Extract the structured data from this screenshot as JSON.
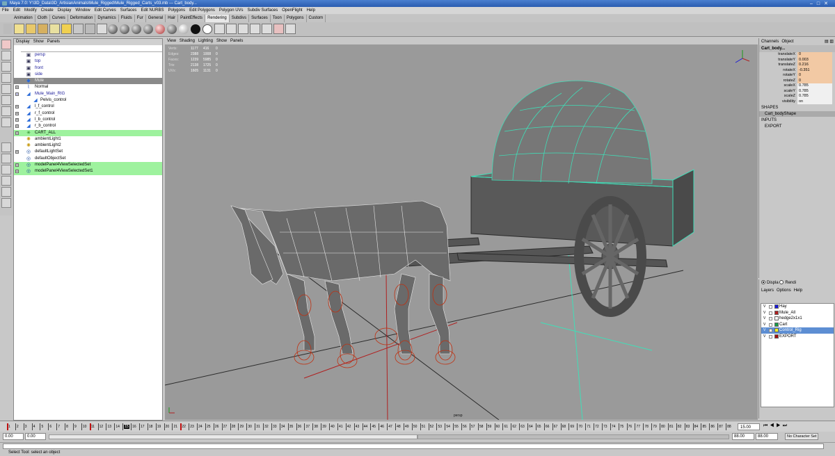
{
  "window": {
    "title": "Maya 7.0: Y:\\3D_Data\\3D_ArtisianAnimals\\Mule_Rigged\\Mule_Rigged_Carts_v03.mb   ---   Cart_body..."
  },
  "menubar": [
    "File",
    "Edit",
    "Modify",
    "Create",
    "Display",
    "Window",
    "Edit Curves",
    "Surfaces",
    "Edit NURBS",
    "Polygons",
    "Edit Polygons",
    "Polygon UVs",
    "Subdiv Surfaces",
    "OpenFlight",
    "Help"
  ],
  "shelf_tabs": [
    "Animation",
    "Cloth",
    "Curves",
    "Deformation",
    "Dynamics",
    "Fluids",
    "Fur",
    "General",
    "Hair",
    "PaintEffects",
    "Rendering",
    "Subdivs",
    "Surfaces",
    "Toon",
    "Polygons",
    "Custom"
  ],
  "shelf_active_tab": "Rendering",
  "outliner": {
    "menus": [
      "Display",
      "Show",
      "Panels"
    ],
    "items": [
      {
        "label": "persp",
        "icon": "camera-icon",
        "expand": false,
        "state": "normal",
        "indent": 0,
        "color": "blue"
      },
      {
        "label": "top",
        "icon": "camera-icon",
        "expand": false,
        "state": "normal",
        "indent": 0,
        "color": "blue"
      },
      {
        "label": "front",
        "icon": "camera-icon",
        "expand": false,
        "state": "normal",
        "indent": 0,
        "color": "blue"
      },
      {
        "label": "side",
        "icon": "camera-icon",
        "expand": false,
        "state": "normal",
        "indent": 0,
        "color": "blue"
      },
      {
        "label": "Mule",
        "icon": "mesh-icon",
        "expand": false,
        "state": "selected",
        "indent": 0,
        "color": "black"
      },
      {
        "label": "Normal",
        "icon": "deformer-icon",
        "expand": true,
        "state": "normal",
        "indent": 0,
        "color": "black"
      },
      {
        "label": "Mule_Main_RIG",
        "icon": "transform-icon",
        "expand": true,
        "state": "normal",
        "indent": 0,
        "color": "blue"
      },
      {
        "label": "Pelvis_control",
        "icon": "transform-icon",
        "expand": false,
        "state": "normal",
        "indent": 1,
        "color": "black"
      },
      {
        "label": "l_f_control",
        "icon": "transform-icon",
        "expand": true,
        "state": "normal",
        "indent": 0,
        "color": "black"
      },
      {
        "label": "r_f_control",
        "icon": "transform-icon",
        "expand": true,
        "state": "normal",
        "indent": 0,
        "color": "black"
      },
      {
        "label": "l_b_control",
        "icon": "transform-icon",
        "expand": true,
        "state": "normal",
        "indent": 0,
        "color": "black"
      },
      {
        "label": "r_b_control",
        "icon": "transform-icon",
        "expand": true,
        "state": "normal",
        "indent": 0,
        "color": "black"
      },
      {
        "label": "CART_ALL",
        "icon": "group-icon",
        "expand": true,
        "state": "highlight",
        "indent": 0,
        "color": "black"
      },
      {
        "label": "ambientLight1",
        "icon": "light-icon",
        "expand": false,
        "state": "normal",
        "indent": 0,
        "color": "black"
      },
      {
        "label": "ambientLight2",
        "icon": "light-icon",
        "expand": false,
        "state": "normal",
        "indent": 0,
        "color": "black"
      },
      {
        "label": "defaultLightSet",
        "icon": "set-icon",
        "expand": true,
        "state": "normal",
        "indent": 0,
        "color": "black"
      },
      {
        "label": "defaultObjectSet",
        "icon": "set-icon",
        "expand": false,
        "state": "normal",
        "indent": 0,
        "color": "black"
      },
      {
        "label": "modelPanel4ViewSelectedSet",
        "icon": "set-icon",
        "expand": true,
        "state": "highlight",
        "indent": 0,
        "color": "black"
      },
      {
        "label": "modelPanel4ViewSelectedSet1",
        "icon": "set-icon",
        "expand": true,
        "state": "highlight",
        "indent": 0,
        "color": "black"
      }
    ]
  },
  "viewport": {
    "menus": [
      "View",
      "Shading",
      "Lighting",
      "Show",
      "Panels"
    ],
    "hud": [
      {
        "label": "Verts:",
        "a": "1177",
        "b": "416",
        "c": "0"
      },
      {
        "label": "Edges:",
        "a": "2388",
        "b": "1008",
        "c": "0"
      },
      {
        "label": "Faces:",
        "a": "1239",
        "b": "5985",
        "c": "0"
      },
      {
        "label": "Tris:",
        "a": "2138",
        "b": "1725",
        "c": "0"
      },
      {
        "label": "UVs:",
        "a": "1605",
        "b": "1131",
        "c": "0"
      }
    ],
    "camera": "persp",
    "axis_label": "x"
  },
  "channelbox": {
    "tabs": [
      "Channels",
      "Object"
    ],
    "object": "Cart_body...",
    "attributes": [
      {
        "name": "translateX",
        "value": "0",
        "keyed": true
      },
      {
        "name": "translateY",
        "value": "0.003",
        "keyed": true
      },
      {
        "name": "translateZ",
        "value": "0.216",
        "keyed": true
      },
      {
        "name": "rotateX",
        "value": "-0.351",
        "keyed": true
      },
      {
        "name": "rotateY",
        "value": "0",
        "keyed": true
      },
      {
        "name": "rotateZ",
        "value": "0",
        "keyed": true
      },
      {
        "name": "scaleX",
        "value": "0.785",
        "keyed": false
      },
      {
        "name": "scaleY",
        "value": "0.785",
        "keyed": false
      },
      {
        "name": "scaleZ",
        "value": "0.785",
        "keyed": false
      },
      {
        "name": "visibility",
        "value": "on",
        "keyed": false
      }
    ],
    "shapes_header": "SHAPES",
    "shape": "Cart_bodyShape",
    "inputs_header": "INPUTS",
    "input": "EXPORT"
  },
  "layers": {
    "radio_display": "Displa",
    "radio_render": "Rendi",
    "menus": [
      "Layers",
      "Options",
      "Help"
    ],
    "items": [
      {
        "label": "Hay",
        "v": "V",
        "color": "#1a1ad8",
        "selected": false
      },
      {
        "label": "Mule_All",
        "v": "V",
        "color": "#b02020",
        "selected": false
      },
      {
        "label": "hedge2x1x1",
        "v": "V",
        "color": "#f8f8f8",
        "selected": false
      },
      {
        "label": "Cart",
        "v": "V",
        "color": "#1a9a4a",
        "selected": false
      },
      {
        "label": "Control_Rig",
        "v": "V",
        "color": "#f0f020",
        "selected": true
      },
      {
        "label": "EXPORT",
        "v": "V",
        "color": "#a01010",
        "selected": false
      }
    ]
  },
  "timeline": {
    "current_frame": "15.00",
    "current_frame_marker": "15",
    "key_frames": [
      1,
      11,
      22
    ],
    "start": "0.00",
    "start2": "0.00",
    "end": "88.00",
    "end2": "88.00",
    "character_set": "No Character Set"
  },
  "help_line": "Select Tool: select an object",
  "colors": {
    "outliner_highlight": "#9ef29e",
    "viewport_bg": "#9a9a9a",
    "wire": "#3fdfb8",
    "rig": "#c03010"
  }
}
